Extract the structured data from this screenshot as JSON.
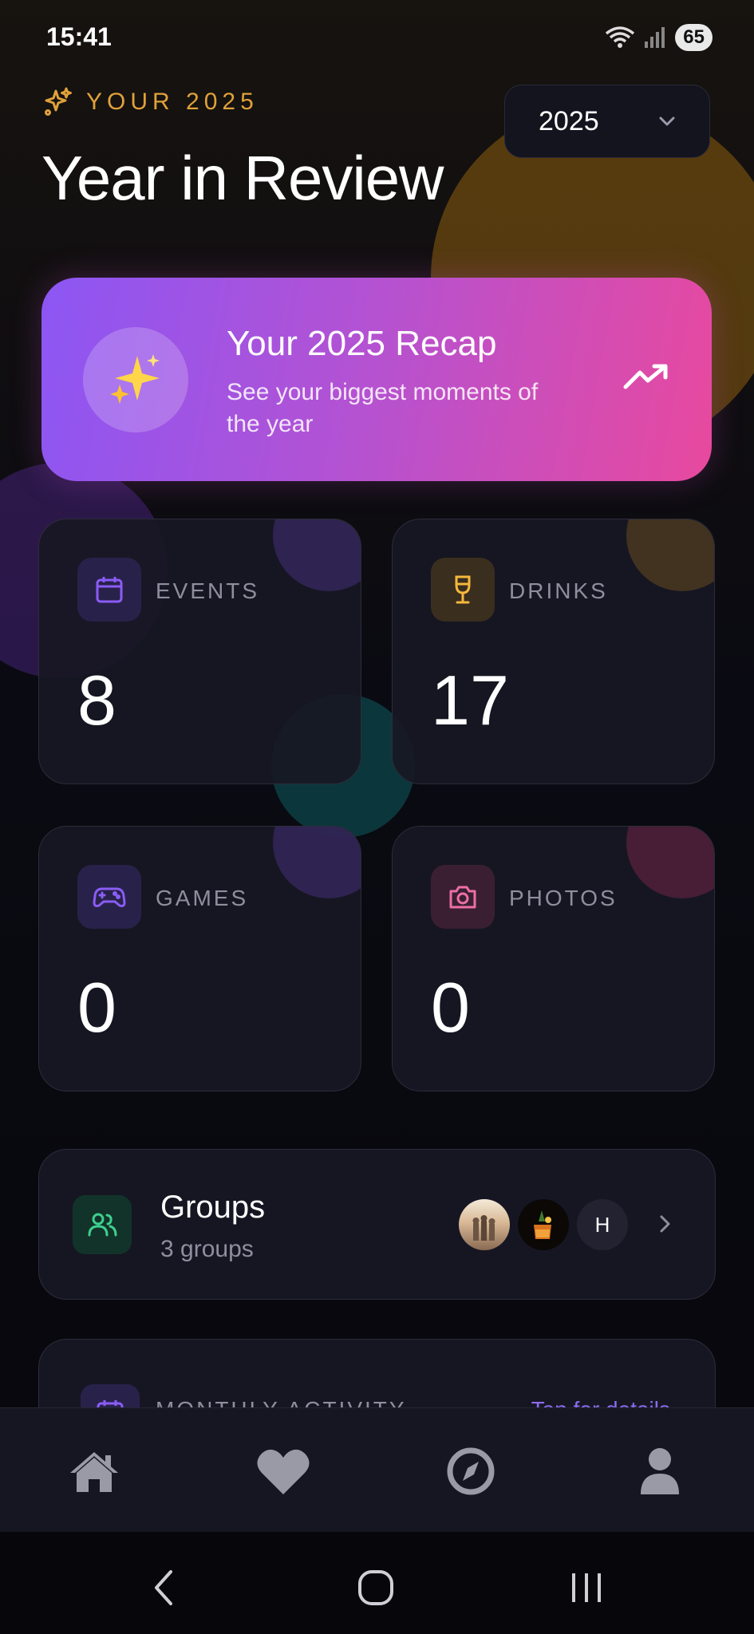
{
  "status_bar": {
    "time": "15:41",
    "battery": "65"
  },
  "header": {
    "eyebrow": "YOUR 2025",
    "title": "Year in Review",
    "year_select": {
      "value": "2025"
    }
  },
  "recap": {
    "emoji": "✨",
    "title": "Your 2025 Recap",
    "subtitle": "See your biggest moments of the year"
  },
  "stats": [
    {
      "label": "EVENTS",
      "value": "8",
      "icon": "calendar-icon",
      "color": "#8b5cf6"
    },
    {
      "label": "DRINKS",
      "value": "17",
      "icon": "wine-glass-icon",
      "color": "#f5b83d"
    },
    {
      "label": "GAMES",
      "value": "0",
      "icon": "gamepad-icon",
      "color": "#8b5cf6"
    },
    {
      "label": "PHOTOS",
      "value": "0",
      "icon": "camera-icon",
      "color": "#ec6fa5"
    }
  ],
  "groups": {
    "title": "Groups",
    "subtitle": "3 groups",
    "avatar_initial": "H"
  },
  "monthly": {
    "label": "MONTHLY ACTIVITY",
    "link": "Tap for details"
  },
  "bottom_nav": [
    "home-icon",
    "heart-icon",
    "compass-icon",
    "profile-icon"
  ],
  "colors": {
    "accent_gold": "#e0a13a",
    "recap_gradient_start": "#8c56f4",
    "recap_gradient_end": "#e8499e",
    "groups_green": "#3ecf8e"
  }
}
